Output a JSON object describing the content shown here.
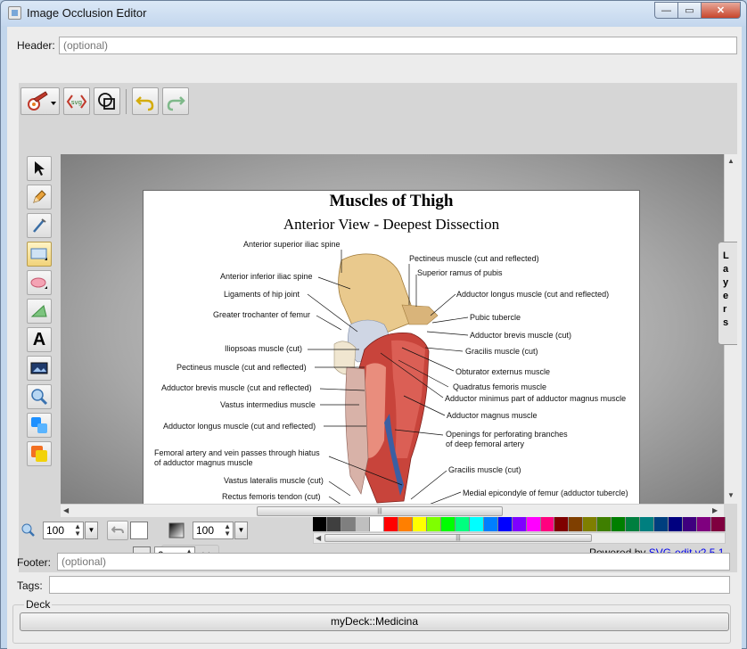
{
  "window": {
    "title": "Image Occlusion Editor",
    "buttons": {
      "minimize": "—",
      "maximize": "▭",
      "close": "✕"
    }
  },
  "header": {
    "label": "Header:",
    "placeholder": "(optional)"
  },
  "footer": {
    "label": "Footer:",
    "placeholder": "(optional)"
  },
  "tags": {
    "label": "Tags:",
    "value": ""
  },
  "deck": {
    "label": "Deck",
    "value": "myDeck::Medicina"
  },
  "editor": {
    "top_toolbar": [
      "main-menu-icon",
      "svg-source-icon",
      "wireframe-icon",
      "undo-icon",
      "redo-icon"
    ],
    "tools": [
      "select-icon",
      "pencil-icon",
      "line-icon",
      "rectangle-icon",
      "ellipse-icon",
      "path-icon",
      "text-icon",
      "image-icon",
      "zoom-icon",
      "fill-stroke-icon",
      "color-swatch-icon"
    ],
    "active_tool": "rectangle-icon",
    "layers_label": "Layers",
    "zoom": "100",
    "opacity": "100",
    "stroke_width": "0",
    "more": ">>",
    "powered_text": "Powered by",
    "powered_link": "SVG-edit v2.5.1",
    "palette": [
      "#000000",
      "#3f3f3f",
      "#7f7f7f",
      "#bfbfbf",
      "#ffffff",
      "#ff0000",
      "#ff7f00",
      "#ffff00",
      "#7fff00",
      "#00ff00",
      "#00ff7f",
      "#00ffff",
      "#007fff",
      "#0000ff",
      "#7f00ff",
      "#ff00ff",
      "#ff007f",
      "#7f0000",
      "#7f3f00",
      "#7f7f00",
      "#3f7f00",
      "#007f00",
      "#007f3f",
      "#007f7f",
      "#003f7f",
      "#00007f",
      "#3f007f",
      "#7f007f",
      "#7f003f"
    ]
  },
  "image": {
    "title": "Muscles of Thigh",
    "subtitle": "Anterior View - Deepest Dissection",
    "labels_left": [
      "Anterior superior iliac spine",
      "Anterior inferior iliac spine",
      "Ligaments of hip joint",
      "Greater trochanter of femur",
      "Iliopsoas muscle (cut)",
      "Pectineus muscle (cut and reflected)",
      "Adductor brevis muscle (cut and reflected)",
      "Vastus intermedius muscle",
      "Adductor longus muscle (cut and reflected)",
      "Femoral artery and vein passes through hiatus",
      "of adductor magnus muscle",
      "Vastus lateralis muscle (cut)",
      "Rectus femoris tendon (cut)"
    ],
    "labels_right": [
      "Pectineus muscle (cut and reflected)",
      "Superior ramus of pubis",
      "Adductor longus muscle (cut and reflected)",
      "Pubic tubercle",
      "Adductor brevis muscle (cut)",
      "Gracilis muscle (cut)",
      "Obturator externus muscle",
      "Quadratus femoris muscle",
      "Adductor minimus part of adductor magnus muscle",
      "Adductor magnus muscle",
      "Openings for perforating branches",
      "of deep femoral artery",
      "Gracilis muscle (cut)",
      "Medial epicondyle of femur (adductor tubercle)"
    ]
  }
}
